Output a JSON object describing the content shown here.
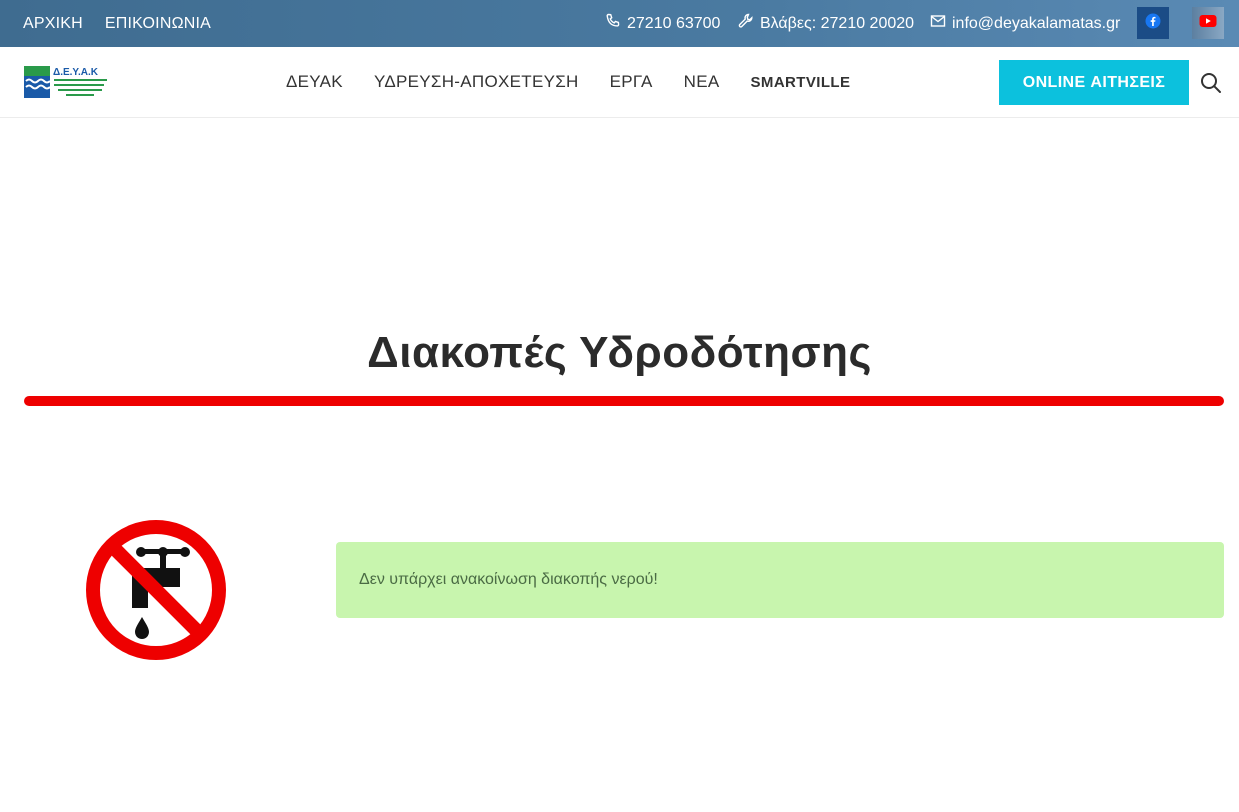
{
  "topbar": {
    "links": [
      "ΑΡΧΙΚΗ",
      "ΕΠΙΚΟΙΝΩΝΙΑ"
    ],
    "phone": "27210 63700",
    "faults": "Βλάβες: 27210 20020",
    "email": "info@deyakalamatas.gr",
    "social": [
      "facebook-icon",
      "youtube-icon"
    ]
  },
  "header": {
    "logo_text": "Δ.Ε.Υ.Α.Κ",
    "nav": [
      "ΔΕΥΑΚ",
      "ΥΔΡΕΥΣΗ-ΑΠΟΧΕΤΕΥΣΗ",
      "ΕΡΓΑ",
      "ΝΕΑ",
      "SMARTVILLE"
    ],
    "cta_label": "ONLINE ΑΙΤΗΣΕΙΣ"
  },
  "main": {
    "title": "Διακοπές Υδροδότησης",
    "notice": "Δεν υπάρχει ανακοίνωση διακοπής νερού!"
  },
  "colors": {
    "topbar": "#4a7aa1",
    "accent": "#0cc1dd",
    "divider": "#ee0000",
    "notice_bg": "#c8f5ae"
  }
}
